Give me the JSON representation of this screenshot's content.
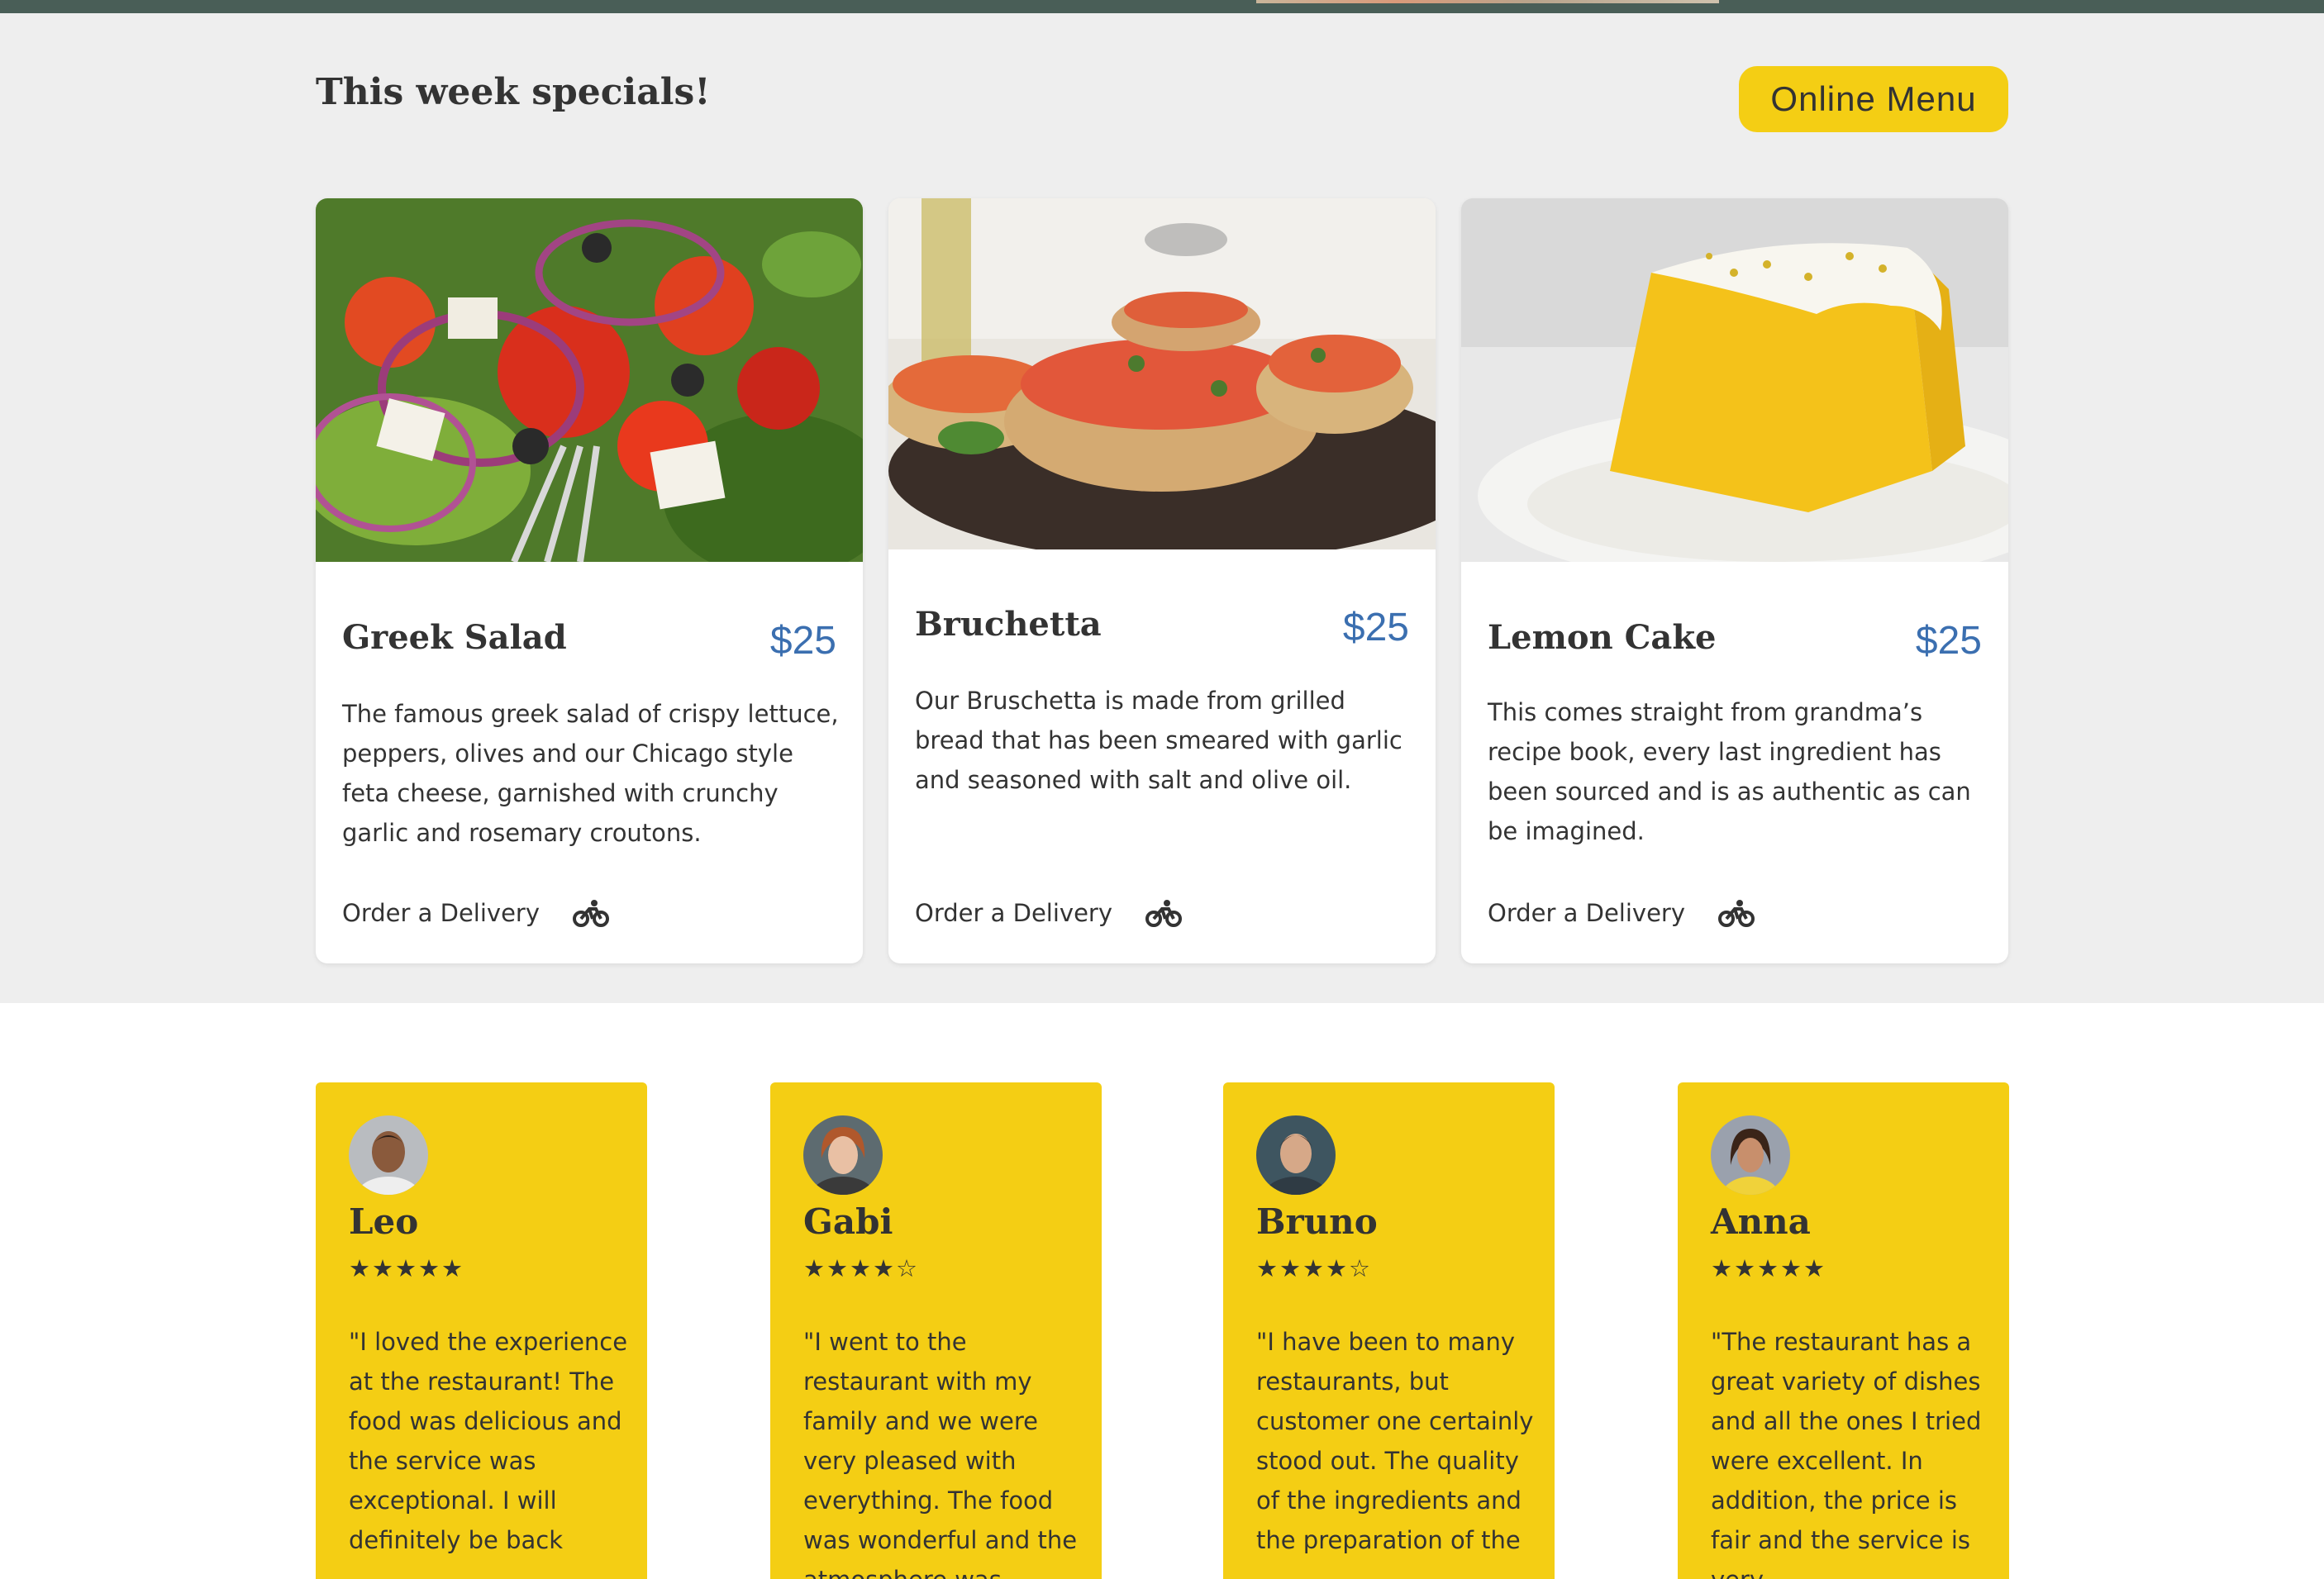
{
  "specials": {
    "title": "This week specials!",
    "menu_button": "Online Menu",
    "cards": [
      {
        "name": "Greek Salad",
        "price": "$25",
        "description": "The famous greek salad of crispy lettuce, peppers, olives and our Chicago style feta cheese, garnished with crunchy garlic and rosemary croutons.",
        "order_label": "Order a Delivery",
        "icon": "bike-icon"
      },
      {
        "name": "Bruchetta",
        "price": "$25",
        "description": "Our Bruschetta is made from grilled bread that has been smeared with garlic and seasoned with salt and olive oil.",
        "order_label": "Order a Delivery",
        "icon": "bike-icon"
      },
      {
        "name": "Lemon Cake",
        "price": "$25",
        "description": "This comes straight from grandma’s recipe book, every last ingredient has been sourced and is as authentic as can be imagined.",
        "order_label": "Order a Delivery",
        "icon": "bike-icon"
      }
    ]
  },
  "testimonials": [
    {
      "name": "Leo",
      "rating": 5,
      "stars": "★★★★★",
      "quote": "\"I loved the experience at the restaurant! The food was delicious and the service was exceptional. I will definitely be back"
    },
    {
      "name": "Gabi",
      "rating": 4,
      "stars": "★★★★☆",
      "quote": "\"I went to the restaurant with my family and we were very pleased with everything. The food was wonderful and the atmosphere was"
    },
    {
      "name": "Bruno",
      "rating": 4,
      "stars": "★★★★☆",
      "quote": "\"I have been to many restaurants, but customer one certainly stood out. The quality of the ingredients and the preparation of the"
    },
    {
      "name": "Anna",
      "rating": 5,
      "stars": "★★★★★",
      "quote": "\"The restaurant has a great variety of dishes and all the ones I tried were excellent. In addition, the price is fair and the service is very"
    }
  ],
  "colors": {
    "header_green": "#495e57",
    "accent_yellow": "#f4ce14",
    "price_blue": "#3b6fb0",
    "section_gray": "#eeeeee"
  }
}
